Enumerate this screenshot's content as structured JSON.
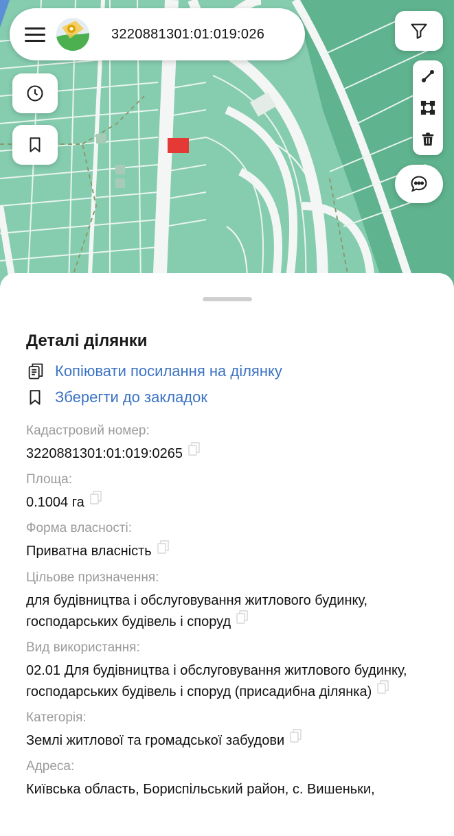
{
  "search": {
    "value": "3220881301:01:019:026"
  },
  "map": {
    "selected_parcel_color": "#e53935",
    "parcel_color": "#7fc8a9",
    "road_color": "#f4f6f5"
  },
  "icons": {
    "menu": "hamburger-icon",
    "logo": "map-pin-logo",
    "filter": "filter-icon",
    "history": "clock-icon",
    "bookmark": "bookmark-icon",
    "measure_line": "ruler-line-icon",
    "measure_area": "polygon-area-icon",
    "delete": "trash-icon",
    "chat": "chat-bubble-icon",
    "copy": "copy-icon"
  },
  "details": {
    "title": "Деталі ділянки",
    "copy_link_label": "Копіювати посилання на ділянку",
    "bookmark_label": "Зберегти до закладок",
    "fields": [
      {
        "label": "Кадастровий номер:",
        "value": "3220881301:01:019:0265"
      },
      {
        "label": "Площа:",
        "value": "0.1004 га"
      },
      {
        "label": "Форма власності:",
        "value": "Приватна власність"
      },
      {
        "label": "Цільове призначення:",
        "value": "для будівництва і обслуговування житлового будинку, господарських будівель і споруд"
      },
      {
        "label": "Вид використання:",
        "value": "02.01 Для будівництва і обслуговування житлового будинку, господарських будівель і споруд (присадибна ділянка)"
      },
      {
        "label": "Категорія:",
        "value": "Землі житлової та громадської забудови"
      },
      {
        "label": "Адреса:",
        "value": "Київська область, Бориспільський район, с. Вишеньки,"
      }
    ]
  }
}
